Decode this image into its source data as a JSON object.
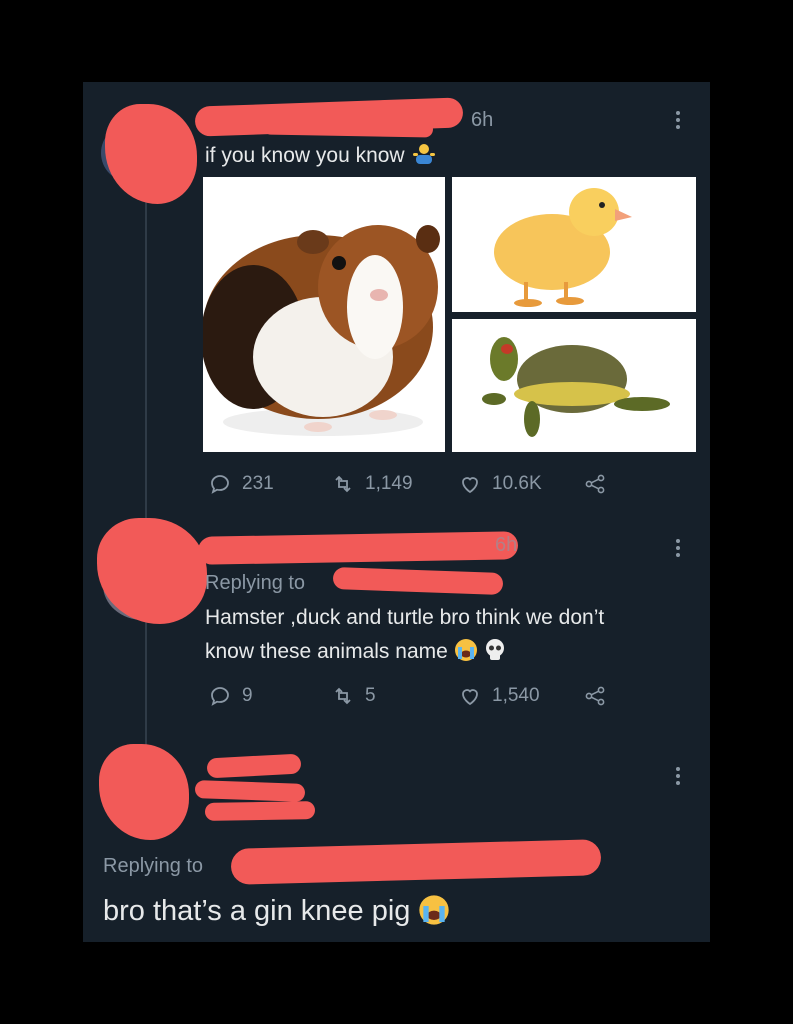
{
  "tweet": {
    "time": "6h",
    "text": "if you know you know",
    "emoji": "person-shrugging-emoji",
    "actions": {
      "replies": "231",
      "retweets": "1,149",
      "likes": "10.6K"
    },
    "images": [
      "guinea-pig-photo",
      "duckling-photo",
      "turtle-photo"
    ]
  },
  "reply1": {
    "time": "6h",
    "replying_to": "Replying to",
    "text_line1": "Hamster ,duck and turtle bro think we don’t",
    "text_line2": "know these animals name",
    "actions": {
      "replies": "9",
      "retweets": "5",
      "likes": "1,540"
    }
  },
  "reply2": {
    "replying_to": "Replying to",
    "text": "bro that’s a gin knee pig"
  },
  "colors": {
    "background": "#16202a",
    "redaction": "#f25a58",
    "muted": "#8b98a5",
    "text": "#e7e9ea"
  }
}
